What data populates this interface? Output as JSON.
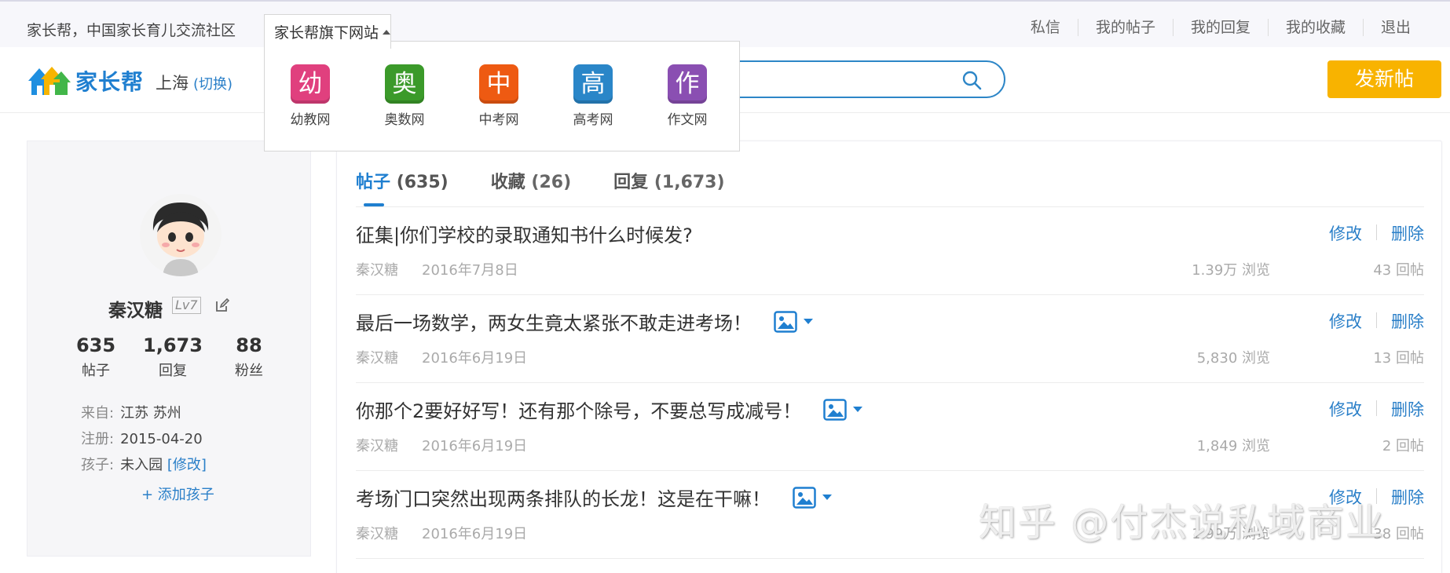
{
  "topbar": {
    "slogan": "家长帮，中国家长育儿交流社区",
    "sites_label": "家长帮旗下网站",
    "nav": [
      "私信",
      "我的帖子",
      "我的回复",
      "我的收藏",
      "退出"
    ]
  },
  "dropdown": {
    "sites": [
      {
        "glyph": "幼",
        "label": "幼教网",
        "color": "#e0407e"
      },
      {
        "glyph": "奥",
        "label": "奥数网",
        "color": "#3b9a2a"
      },
      {
        "glyph": "中",
        "label": "中考网",
        "color": "#ee5a12"
      },
      {
        "glyph": "高",
        "label": "高考网",
        "color": "#2a86c8"
      },
      {
        "glyph": "作",
        "label": "作文网",
        "color": "#8a4fb2"
      }
    ]
  },
  "header": {
    "logo_text": "家长帮",
    "city": "上海",
    "city_switch": "(切换)",
    "post_button": "发新帖"
  },
  "profile": {
    "name": "秦汉糖",
    "level": "Lv7",
    "stats": [
      {
        "num": "635",
        "label": "帖子"
      },
      {
        "num": "1,673",
        "label": "回复"
      },
      {
        "num": "88",
        "label": "粉丝"
      }
    ],
    "from_label": "来自:",
    "from_value": "江苏 苏州",
    "reg_label": "注册:",
    "reg_value": "2015-04-20",
    "kid_label": "孩子:",
    "kid_value": "未入园",
    "kid_edit": "[修改]",
    "add_child": "+ 添加孩子"
  },
  "tabs": [
    {
      "label": "帖子",
      "count": "(635)",
      "active": true
    },
    {
      "label": "收藏",
      "count": "(26)",
      "active": false
    },
    {
      "label": "回复",
      "count": "(1,673)",
      "active": false
    }
  ],
  "posts": [
    {
      "title": "征集|你们学校的录取通知书什么时候发?",
      "has_image": false,
      "author": "秦汉糖",
      "date": "2016年7月8日",
      "views": "1.39万 浏览",
      "replies": "43 回帖",
      "edit": "修改",
      "delete": "删除"
    },
    {
      "title": "最后一场数学，两女生竟太紧张不敢走进考场！",
      "has_image": true,
      "author": "秦汉糖",
      "date": "2016年6月19日",
      "views": "5,830 浏览",
      "replies": "13 回帖",
      "edit": "修改",
      "delete": "删除"
    },
    {
      "title": "你那个2要好好写！还有那个除号，不要总写成减号！",
      "has_image": true,
      "author": "秦汉糖",
      "date": "2016年6月19日",
      "views": "1,849 浏览",
      "replies": "2 回帖",
      "edit": "修改",
      "delete": "删除"
    },
    {
      "title": "考场门口突然出现两条排队的长龙！这是在干嘛！",
      "has_image": true,
      "author": "秦汉糖",
      "date": "2016年6月19日",
      "views": "1.99万 浏览",
      "replies": "38 回帖",
      "edit": "修改",
      "delete": "删除"
    }
  ],
  "watermark": "知乎 @付杰说私域商业"
}
